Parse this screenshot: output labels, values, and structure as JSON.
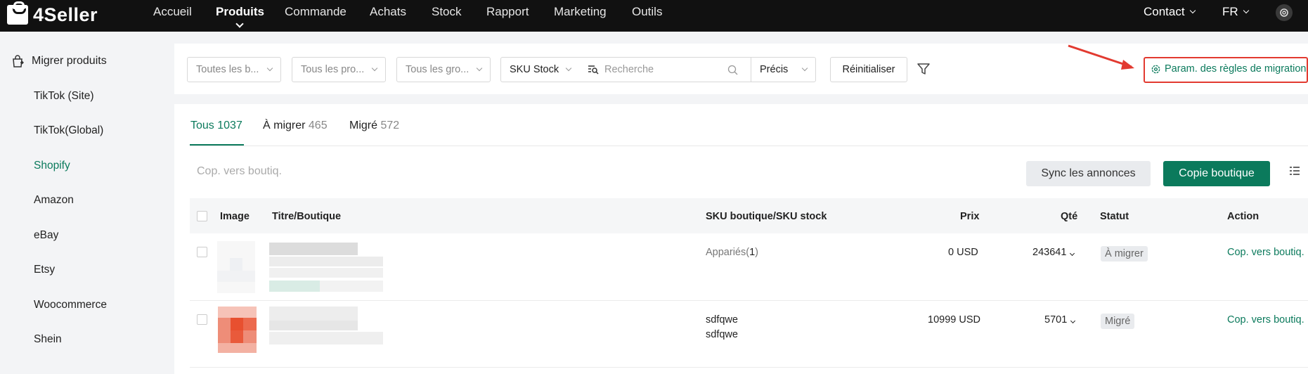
{
  "header": {
    "logo": "4Seller",
    "nav": [
      "Accueil",
      "Produits",
      "Commande",
      "Achats",
      "Stock",
      "Rapport",
      "Marketing",
      "Outils"
    ],
    "active_nav": "Produits",
    "contact": "Contact",
    "lang": "FR"
  },
  "sidebar": {
    "title": "Migrer produits",
    "items": [
      "TikTok (Site)",
      "TikTok(Global)",
      "Shopify",
      "Amazon",
      "eBay",
      "Etsy",
      "Woocommerce",
      "Shein"
    ],
    "active": "Shopify"
  },
  "filters": {
    "boutique": "Toutes les b...",
    "produits": "Tous les pro...",
    "groupes": "Tous les gro...",
    "sku_type": "SKU Stock",
    "search_placeholder": "Recherche",
    "match": "Précis",
    "reset": "Réinitialiser",
    "param_rules": "Param. des règles de migration"
  },
  "tabs": [
    {
      "label": "Tous",
      "count": "1037"
    },
    {
      "label": "À migrer",
      "count": "465"
    },
    {
      "label": "Migré",
      "count": "572"
    }
  ],
  "toolbar": {
    "copy_placeholder": "Cop. vers boutiq.",
    "sync": "Sync les annonces",
    "copy_shop": "Copie boutique"
  },
  "table": {
    "columns": [
      "Image",
      "Titre/Boutique",
      "SKU boutique/SKU stock",
      "Prix",
      "Qté",
      "Statut",
      "Action"
    ],
    "rows": [
      {
        "sku_prefix": "Appariés(",
        "sku_count": "1",
        "sku_suffix": ")",
        "price": "0 USD",
        "qty": "243641",
        "status": "À migrer",
        "action": "Cop. vers boutiq."
      },
      {
        "sku1": "sdfqwe",
        "sku2": "sdfqwe",
        "price": "10999 USD",
        "qty": "5701",
        "status": "Migré",
        "action": "Cop. vers boutiq."
      }
    ]
  },
  "colors": {
    "accent": "#0b7a5c",
    "highlight": "#e23a30",
    "topbar": "#111111"
  }
}
